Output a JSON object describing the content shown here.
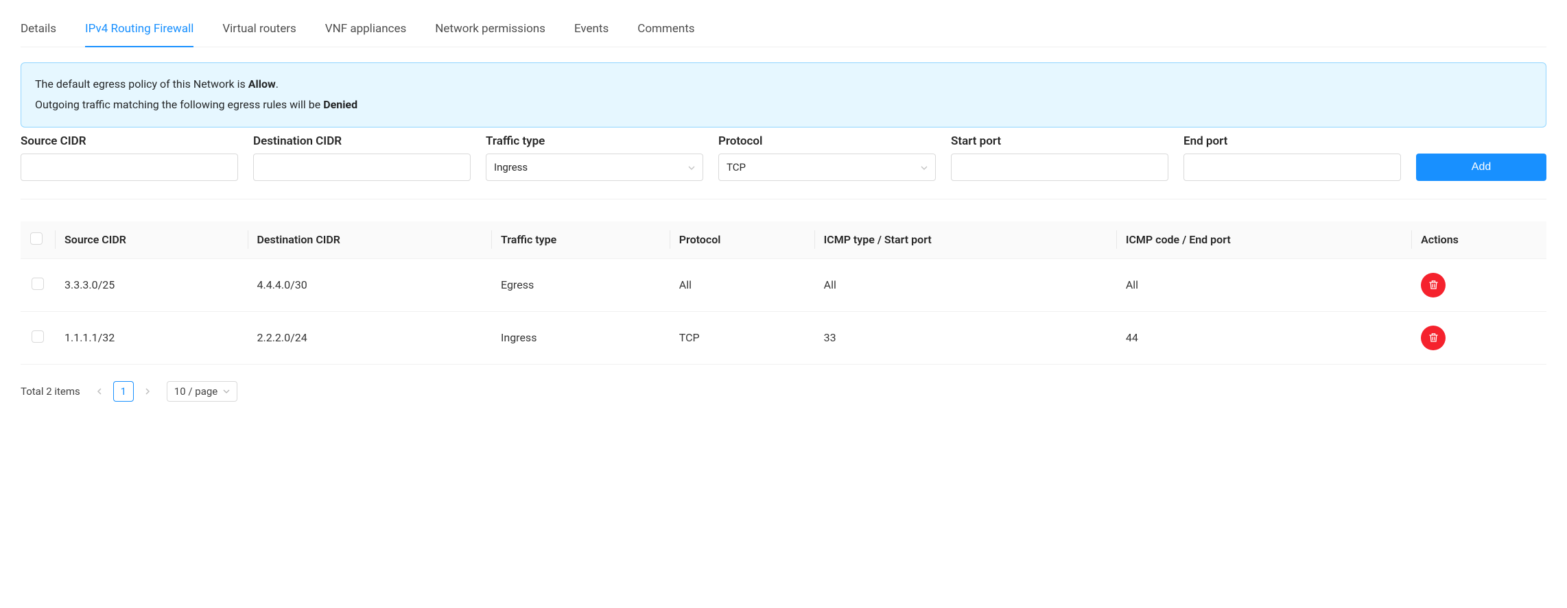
{
  "tabs": [
    {
      "label": "Details"
    },
    {
      "label": "IPv4 Routing Firewall"
    },
    {
      "label": "Virtual routers"
    },
    {
      "label": "VNF appliances"
    },
    {
      "label": "Network permissions"
    },
    {
      "label": "Events"
    },
    {
      "label": "Comments"
    }
  ],
  "active_tab_index": 1,
  "alert": {
    "line1_a": "The default egress policy of this Network is ",
    "line1_b": "Allow",
    "line1_c": ".",
    "line2_a": "Outgoing traffic matching the following egress rules will be ",
    "line2_b": "Denied"
  },
  "form": {
    "source_cidr": {
      "label": "Source CIDR",
      "value": ""
    },
    "dest_cidr": {
      "label": "Destination CIDR",
      "value": ""
    },
    "traffic_type": {
      "label": "Traffic type",
      "value": "Ingress"
    },
    "protocol": {
      "label": "Protocol",
      "value": "TCP"
    },
    "start_port": {
      "label": "Start port",
      "value": ""
    },
    "end_port": {
      "label": "End port",
      "value": ""
    },
    "add_button": "Add"
  },
  "table": {
    "headers": {
      "source_cidr": "Source CIDR",
      "dest_cidr": "Destination CIDR",
      "traffic_type": "Traffic type",
      "protocol": "Protocol",
      "icmp_start": "ICMP type / Start port",
      "icmp_end": "ICMP code / End port",
      "actions": "Actions"
    },
    "rows": [
      {
        "source": "3.3.3.0/25",
        "dest": "4.4.4.0/30",
        "traffic": "Egress",
        "protocol": "All",
        "start": "All",
        "end": "All"
      },
      {
        "source": "1.1.1.1/32",
        "dest": "2.2.2.0/24",
        "traffic": "Ingress",
        "protocol": "TCP",
        "start": "33",
        "end": "44"
      }
    ]
  },
  "pagination": {
    "total_text": "Total 2 items",
    "current_page": "1",
    "page_size": "10 / page"
  }
}
